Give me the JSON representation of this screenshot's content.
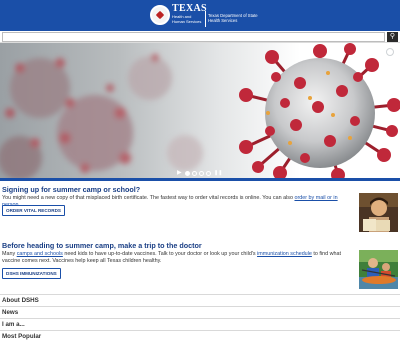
{
  "header": {
    "brand_texas": "TEXAS",
    "brand_sub": "Health and Human Services",
    "brand_right": "Texas Department of State Health Services"
  },
  "search": {
    "placeholder": "",
    "button_icon": "search-icon"
  },
  "hero": {
    "image": "coronavirus-illustration",
    "slides": 4,
    "active_slide": 1
  },
  "cards": [
    {
      "title": "Signing up for summer camp or school?",
      "text_before": "You might need a new copy of that misplaced birth certificate. The fastest way to order vital records is online. You can also ",
      "link": "order by mail or in person",
      "text_after": ".",
      "button": "ORDER VITAL RECORDS",
      "thumb": "child-with-book-photo"
    },
    {
      "title": "Before heading to summer camp, make a trip to the doctor",
      "text_a": "Many ",
      "link_a": "camps and schools",
      "text_b": " need kids to have up-to-date vaccines. Talk to your doctor or look up your child's ",
      "link_b": "immunization schedule",
      "text_c": " to find what vaccine comes next. Vaccines help keep all Texas children healthy.",
      "button": "DSHS IMMUNIZATIONS",
      "thumb": "kids-kayaking-photo"
    }
  ],
  "nav": [
    "About DSHS",
    "News",
    "I am a...",
    "Most Popular"
  ],
  "colors": {
    "brand_blue": "#1a4fa8",
    "title_blue": "#1a3f85",
    "virus_red": "#c0283a"
  }
}
